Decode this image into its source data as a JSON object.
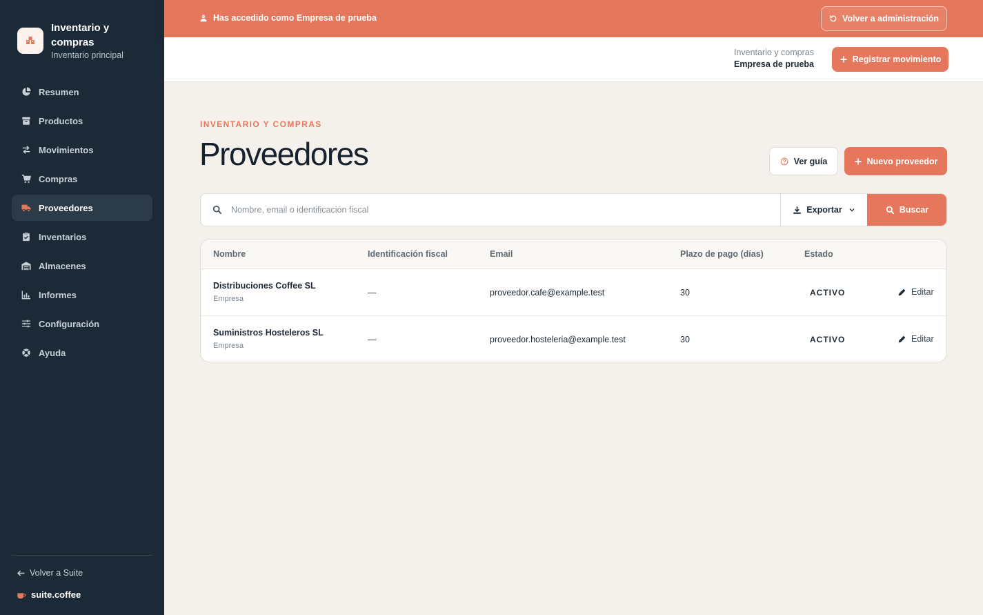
{
  "sidebar": {
    "brand_title": "Inventario y compras",
    "brand_subtitle": "Inventario principal",
    "items": [
      {
        "label": "Resumen",
        "icon": "pie-chart-icon"
      },
      {
        "label": "Productos",
        "icon": "box-icon"
      },
      {
        "label": "Movimientos",
        "icon": "arrows-exchange-icon"
      },
      {
        "label": "Compras",
        "icon": "cart-icon"
      },
      {
        "label": "Proveedores",
        "icon": "truck-icon",
        "active": true
      },
      {
        "label": "Inventarios",
        "icon": "clipboard-check-icon"
      },
      {
        "label": "Almacenes",
        "icon": "warehouse-icon"
      },
      {
        "label": "Informes",
        "icon": "bar-chart-icon"
      },
      {
        "label": "Configuración",
        "icon": "sliders-icon"
      },
      {
        "label": "Ayuda",
        "icon": "lifebuoy-icon"
      }
    ],
    "back_label": "Volver a Suite",
    "suite_label": "suite.coffee"
  },
  "banner": {
    "message": "Has accedido como Empresa de prueba",
    "back_button": "Volver a administración"
  },
  "topbar": {
    "app_name": "Inventario y compras",
    "company": "Empresa de prueba",
    "register_button": "Registrar movimiento"
  },
  "page": {
    "eyebrow": "INVENTARIO Y COMPRAS",
    "title": "Proveedores",
    "guide_button": "Ver guía",
    "new_button": "Nuevo proveedor"
  },
  "search": {
    "placeholder": "Nombre, email o identificación fiscal",
    "value": "",
    "export_label": "Exportar",
    "search_button": "Buscar"
  },
  "table": {
    "columns": [
      "Nombre",
      "Identificación fiscal",
      "Email",
      "Plazo de pago (días)",
      "Estado"
    ],
    "rows": [
      {
        "name": "Distribuciones Coffee SL",
        "type": "Empresa",
        "tax_id": "—",
        "email": "proveedor.cafe@example.test",
        "payment_days": "30",
        "status": "ACTIVO",
        "action": "Editar"
      },
      {
        "name": "Suministros Hosteleros SL",
        "type": "Empresa",
        "tax_id": "—",
        "email": "proveedor.hosteleria@example.test",
        "payment_days": "30",
        "status": "ACTIVO",
        "action": "Editar"
      }
    ]
  },
  "colors": {
    "accent": "#e5785c",
    "sidebar_bg": "#1b2a36",
    "page_bg": "#f4f1ec"
  }
}
